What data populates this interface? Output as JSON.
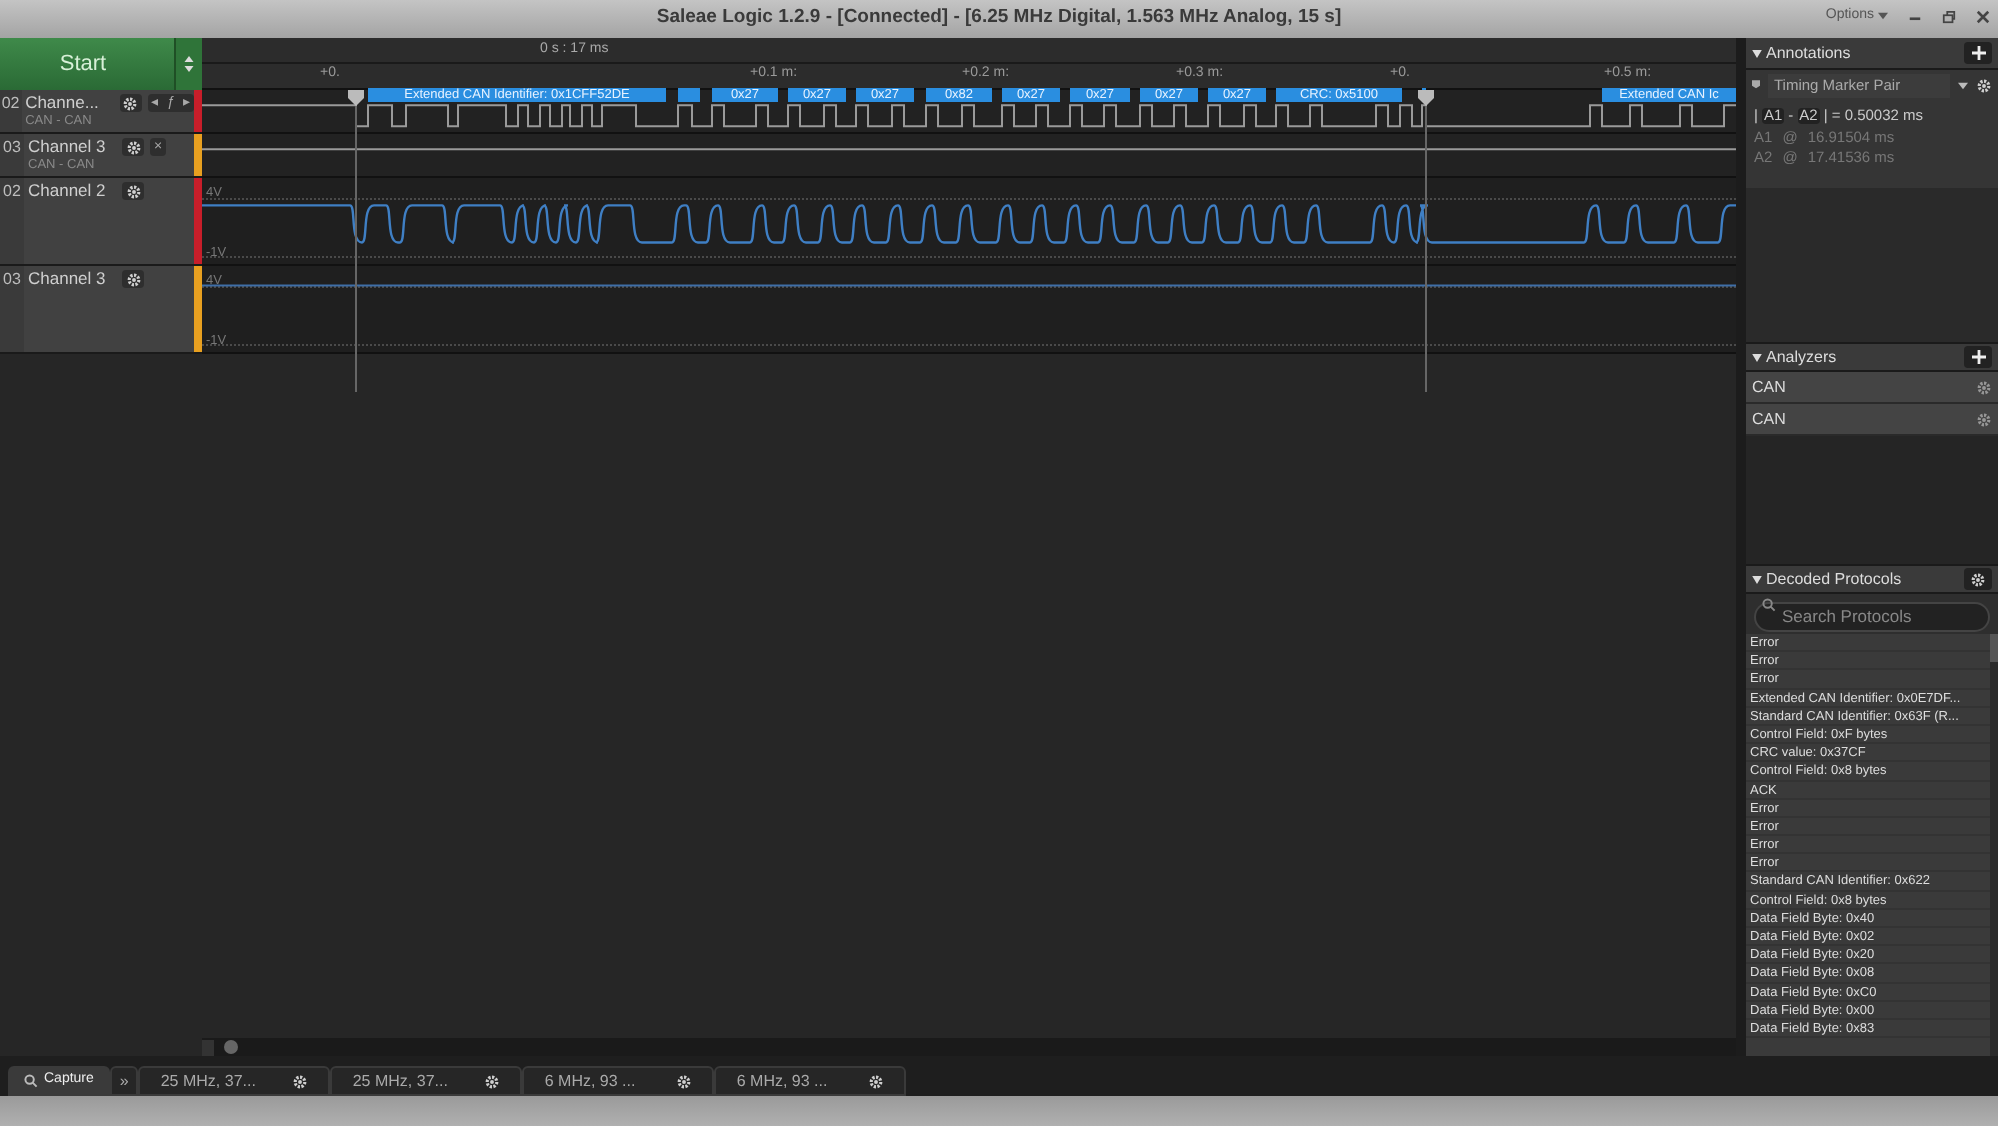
{
  "window": {
    "title": "Saleae Logic 1.2.9 - [Connected] - [6.25 MHz Digital, 1.563 MHz Analog, 15 s]",
    "options": "Options"
  },
  "start_button": "Start",
  "timeline": {
    "time_label": "0 s : 17 ms",
    "ticks": [
      "+0.",
      "+0.1 m:",
      "+0.2 m:",
      "+0.3 m:",
      "+0.",
      "+0.5 m:"
    ]
  },
  "channels": [
    {
      "number": "02",
      "name": "Channe...",
      "analyzer": "CAN - CAN",
      "kind": "digital",
      "color": "#c81e2a",
      "controls": [
        "◂",
        "ƒ",
        "▸"
      ]
    },
    {
      "number": "03",
      "name": "Channel 3",
      "analyzer": "CAN - CAN",
      "kind": "digital",
      "color": "#e8a020",
      "controls": [
        "×"
      ]
    },
    {
      "number": "02",
      "name": "Channel 2",
      "kind": "analog",
      "color": "#c81e2a",
      "scale": [
        "4V",
        "-1V"
      ]
    },
    {
      "number": "03",
      "name": "Channel 3",
      "kind": "analog",
      "color": "#e8a020",
      "scale": [
        "4V",
        "-1V"
      ]
    }
  ],
  "decoded_bubbles": [
    "Extended CAN Identifier: 0x1CFF52DE",
    "0x27",
    "0x27",
    "0x27",
    "0x82",
    "0x27",
    "0x27",
    "0x27",
    "0x27",
    "CRC: 0x5100",
    "Extended CAN Ic"
  ],
  "annotations": {
    "title": "Annotations",
    "marker_pair": "Timing Marker Pair",
    "difference": {
      "open": "|",
      "a": "A1",
      "sep": "-",
      "b": "A2",
      "value": "| = 0.50032 ms"
    },
    "markers": [
      {
        "marker": "A1",
        "at": "@",
        "time": "16.91504 ms"
      },
      {
        "marker": "A2",
        "at": "@",
        "time": "17.41536 ms"
      }
    ]
  },
  "analyzers": {
    "title": "Analyzers",
    "items": [
      "CAN",
      "CAN"
    ]
  },
  "decoded_protocols": {
    "title": "Decoded Protocols",
    "placeholder": "Search Protocols",
    "rows": [
      "Error",
      "Error",
      "Error",
      "Extended CAN Identifier: 0x0E7DF...",
      "Standard CAN Identifier: 0x63F (R...",
      "Control Field: 0xF bytes",
      "CRC value: 0x37CF",
      "Control Field: 0x8 bytes",
      "ACK",
      "Error",
      "Error",
      "Error",
      "Error",
      "Standard CAN Identifier: 0x622",
      "Control Field: 0x8 bytes",
      "Data Field Byte: 0x40",
      "Data Field Byte: 0x02",
      "Data Field Byte: 0x20",
      "Data Field Byte: 0x08",
      "Data Field Byte: 0xC0",
      "Data Field Byte: 0x00",
      "Data Field Byte: 0x83"
    ]
  },
  "tabs": [
    {
      "label": "Capture",
      "kind": "capture",
      "selected": true
    },
    {
      "label": "»",
      "kind": "more",
      "selected": false
    },
    {
      "label": "25 MHz, 37...",
      "kind": "session",
      "selected": false
    },
    {
      "label": "25 MHz, 37...",
      "kind": "session",
      "selected": false
    },
    {
      "label": "6 MHz, 93 ...",
      "kind": "session",
      "selected": false
    },
    {
      "label": "6 MHz, 93 ...",
      "kind": "session",
      "selected": false
    }
  ]
}
